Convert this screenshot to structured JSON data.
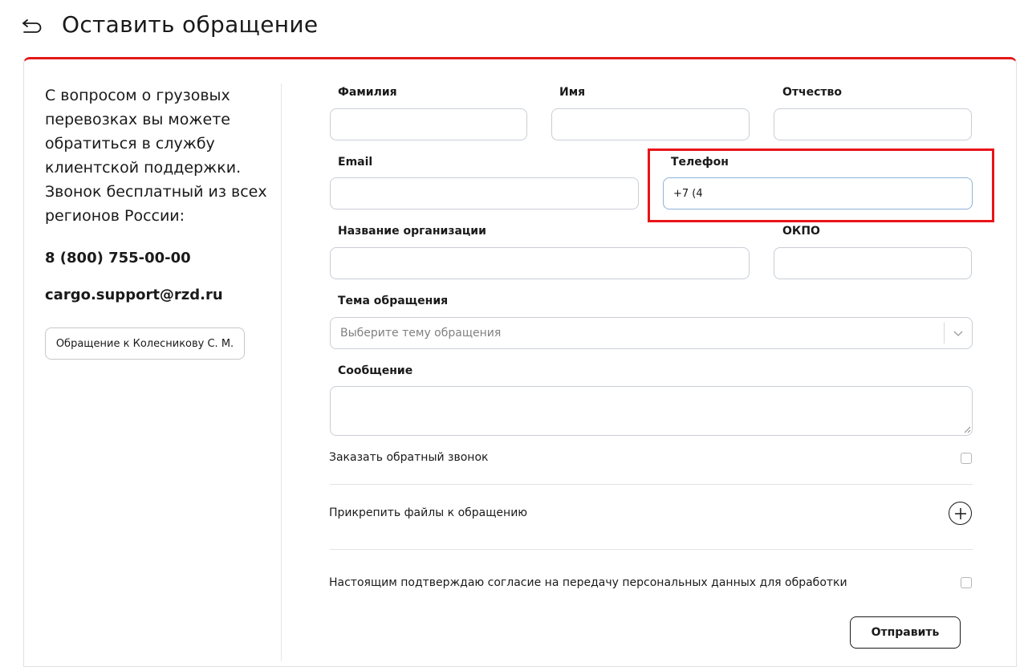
{
  "header": {
    "title": "Оставить обращение",
    "back_icon": "back-arrow-icon"
  },
  "sidebar": {
    "info_text": "С вопросом о грузовых перевозках вы можете обратиться в службу клиентской поддержки. Звонок бесплатный из всех регионов России:",
    "phone": "8 (800) 755-00-00",
    "email": "cargo.support@rzd.ru",
    "appeal_button": "Обращение к Колесникову С. М."
  },
  "form": {
    "last_name": {
      "label": "Фамилия",
      "value": ""
    },
    "first_name": {
      "label": "Имя",
      "value": ""
    },
    "patronymic": {
      "label": "Отчество",
      "value": ""
    },
    "email": {
      "label": "Email",
      "value": ""
    },
    "phone": {
      "label": "Телефон",
      "value": "+7 (4"
    },
    "organization": {
      "label": "Название организации",
      "value": ""
    },
    "okpo": {
      "label": "ОКПО",
      "value": ""
    },
    "topic": {
      "label": "Тема обращения",
      "placeholder": "Выберите тему обращения"
    },
    "message": {
      "label": "Сообщение",
      "value": ""
    },
    "callback": {
      "label": "Заказать обратный звонок",
      "checked": false
    },
    "attach": {
      "label": "Прикрепить файлы к обращению",
      "icon": "plus-circle-icon"
    },
    "consent": {
      "label": "Настоящим подтверждаю согласие на передачу персональных данных для обработки",
      "checked": false
    },
    "submit_label": "Отправить"
  },
  "colors": {
    "accent_red": "#e21a1a",
    "highlight_red": "#e8141a",
    "field_border": "#c9ced6",
    "focused_border": "#8fb2d9"
  }
}
